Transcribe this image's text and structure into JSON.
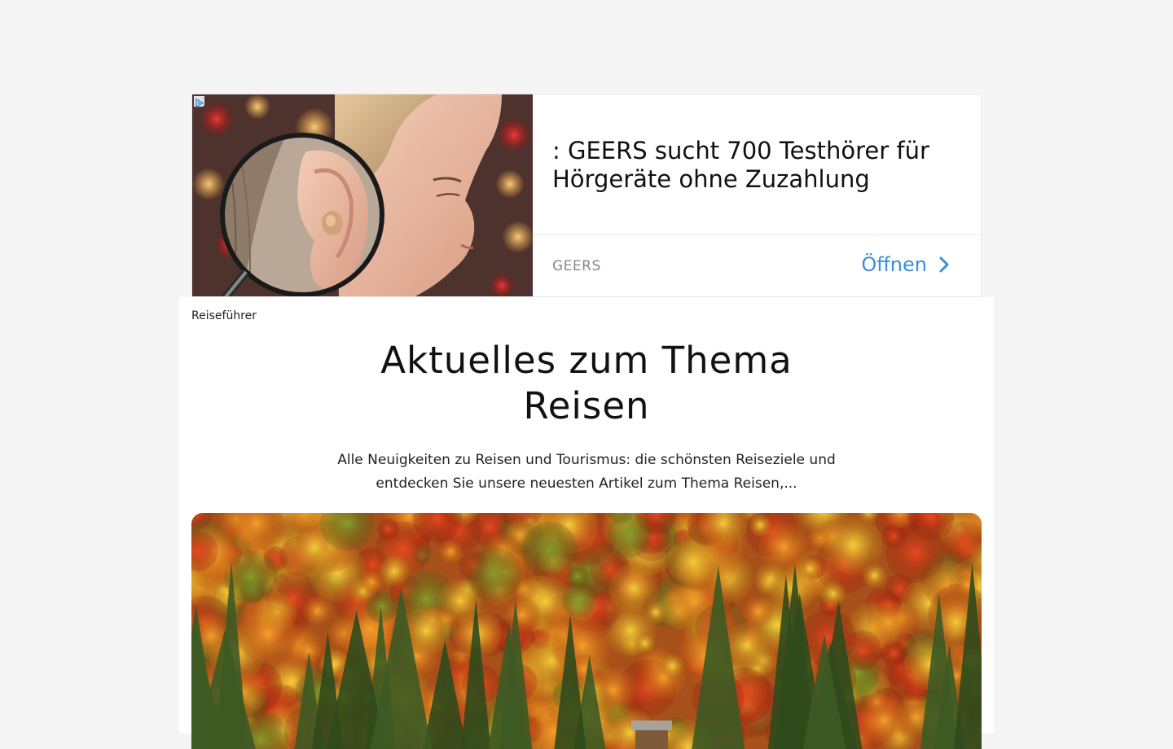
{
  "ad": {
    "headline": ": GEERS sucht 700 Testhörer für Hörgeräte ohne Zuzahlung",
    "advertiser": "GEERS",
    "cta_label": "Öffnen",
    "accent_color": "#3b8fd9"
  },
  "breadcrumb": {
    "label": "Reiseführer"
  },
  "page": {
    "title_line1": "Aktuelles zum Thema",
    "title_line2": "Reisen",
    "intro": "Alle Neuigkeiten zu Reisen und Tourismus: die schönsten Reiseziele und entdecken Sie unsere neuesten Artikel zum Thema Reisen,..."
  },
  "hero": {
    "image": "autumn-forest-photo"
  }
}
